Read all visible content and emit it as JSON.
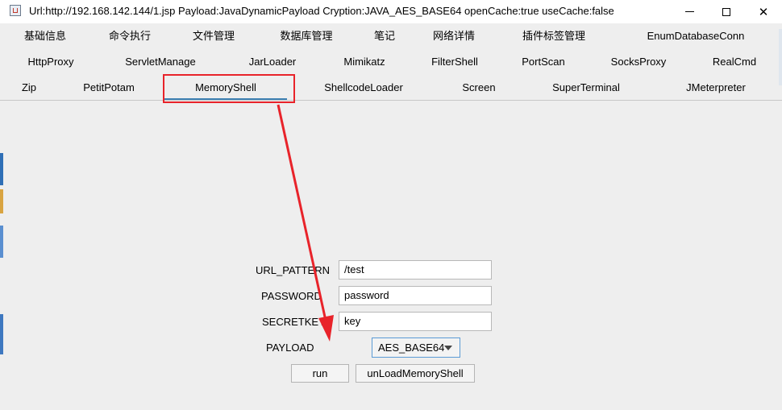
{
  "window": {
    "title": "Url:http://192.168.142.144/1.jsp Payload:JavaDynamicPayload Cryption:JAVA_AES_BASE64 openCache:true useCache:false",
    "minimize_glyph": "",
    "maximize_glyph": "",
    "close_glyph": "✕"
  },
  "tabs": {
    "row1": [
      "基础信息",
      "命令执行",
      "文件管理",
      "数据库管理",
      "笔记",
      "网络详情",
      "插件标签管理",
      "EnumDatabaseConn"
    ],
    "row2": [
      "HttpProxy",
      "ServletManage",
      "JarLoader",
      "Mimikatz",
      "FilterShell",
      "PortScan",
      "SocksProxy",
      "RealCmd"
    ],
    "row3": [
      "Zip",
      "PetitPotam",
      "MemoryShell",
      "ShellcodeLoader",
      "Screen",
      "SuperTerminal",
      "JMeterpreter"
    ],
    "selected": "MemoryShell"
  },
  "form": {
    "url_pattern_label": "URL_PATTERN",
    "url_pattern_value": "/test",
    "password_label": "PASSWORD",
    "password_value": "password",
    "secretkey_label": "SECRETKEY",
    "secretkey_value": "key",
    "payload_label": "PAYLOAD",
    "payload_selected": "AES_BASE64"
  },
  "buttons": {
    "run": "run",
    "unload": "unLoadMemoryShell"
  },
  "colors": {
    "annotation_red": "#e8232a",
    "tab_underline": "#3c7fb1",
    "combo_border": "#5b9bd5"
  },
  "icons": {
    "app": "java-cup-icon",
    "dropdown": "chevron-down-icon"
  }
}
